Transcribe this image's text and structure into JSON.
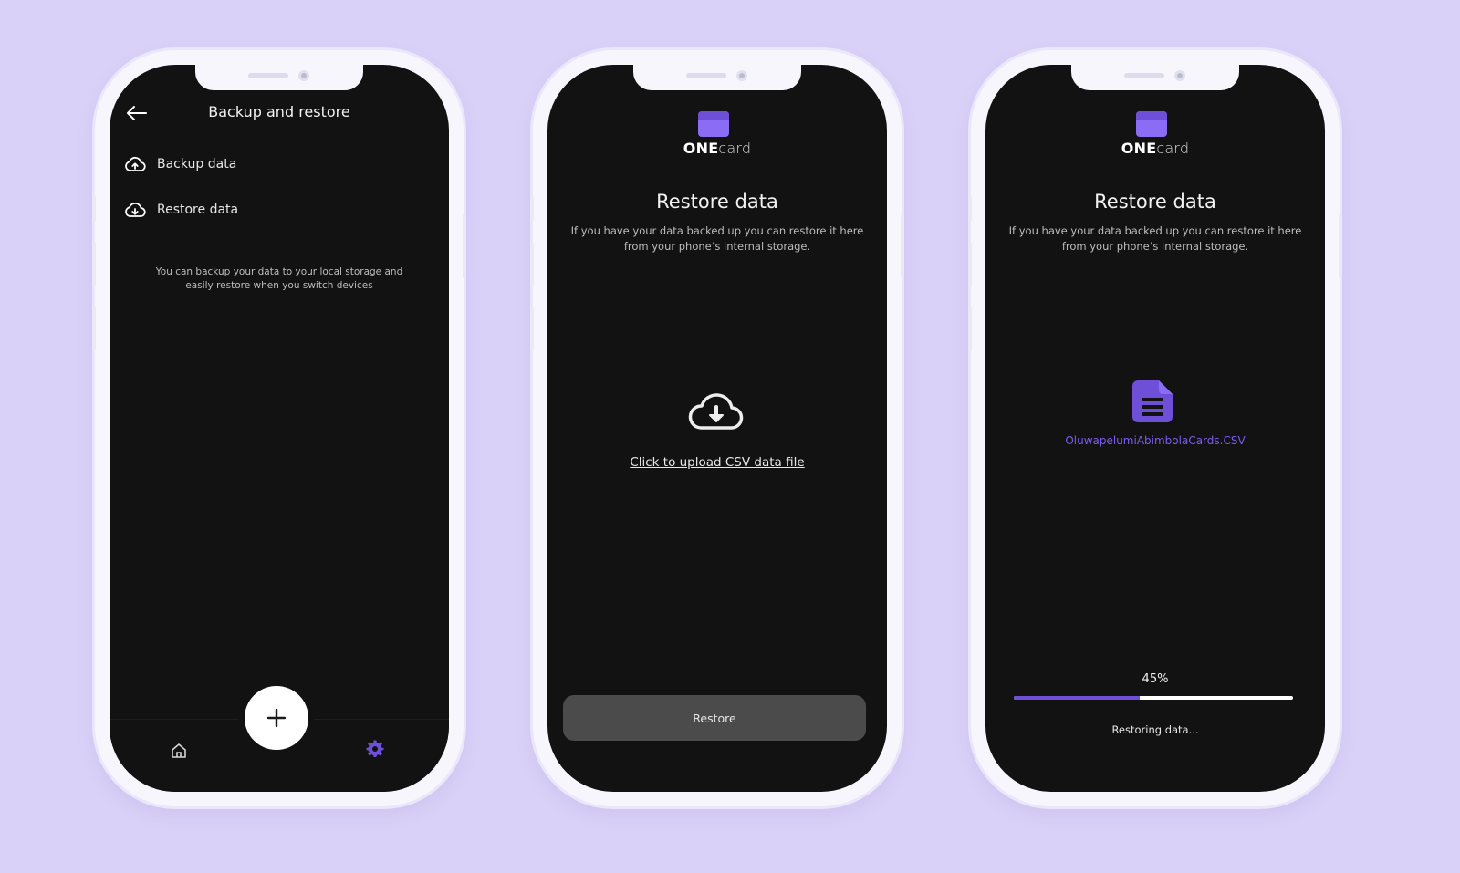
{
  "colors": {
    "background": "#d9d1f7",
    "accent": "#7b5cf0",
    "screen": "#121212"
  },
  "screen1": {
    "title": "Backup and restore",
    "back_icon": "arrow-left-icon",
    "items": [
      {
        "label": "Backup data",
        "icon": "cloud-upload-icon"
      },
      {
        "label": "Restore data",
        "icon": "cloud-download-icon"
      }
    ],
    "note": "You can backup your data to your local storage and easily restore when you switch devices",
    "nav": {
      "home_icon": "home-icon",
      "add_icon": "plus-icon",
      "settings_icon": "gear-icon"
    }
  },
  "screen2": {
    "logo": {
      "bold": "ONE",
      "light": "card"
    },
    "title": "Restore data",
    "subtitle": "If you have your data backed up you can restore it here from your phone’s internal storage.",
    "upload_icon": "cloud-download-icon",
    "upload_link": "Click to upload CSV data file",
    "restore_button": "Restore"
  },
  "screen3": {
    "logo": {
      "bold": "ONE",
      "light": "card"
    },
    "title": "Restore data",
    "subtitle": "If you have your data backed up you can restore it here from your phone’s internal storage.",
    "file_icon": "document-icon",
    "file_name": "OluwapelumiAbimbolaCards.CSV",
    "progress_percent": 45,
    "progress_label": "45%",
    "status": "Restoring data..."
  }
}
